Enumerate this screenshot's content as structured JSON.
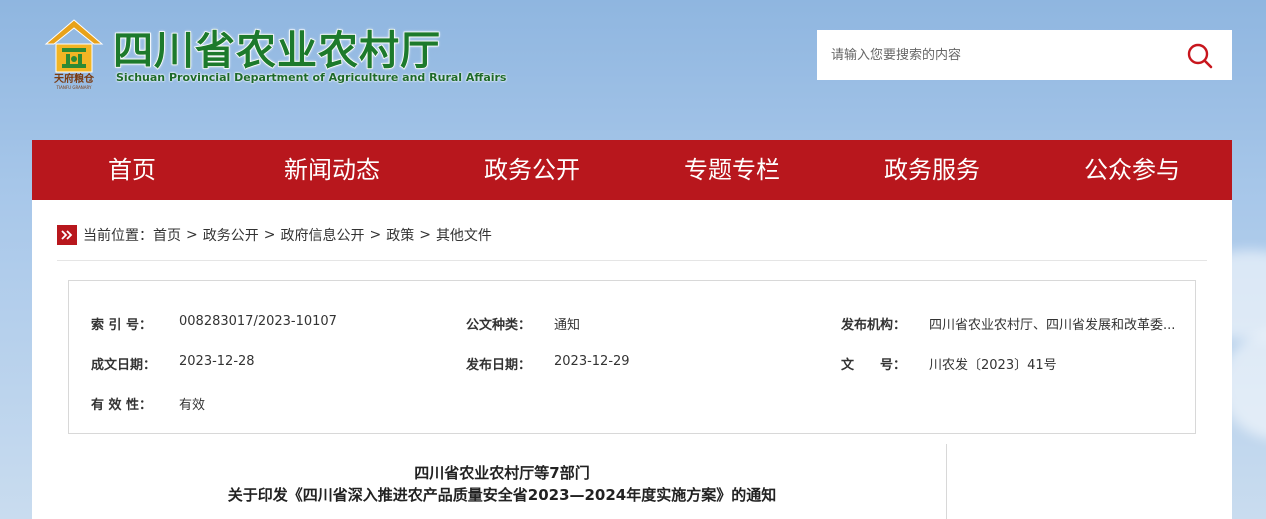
{
  "header": {
    "emblem_caption": "天府粮仓",
    "emblem_caption_en": "TIANFU GRANARY",
    "title_cn": "四川省农业农村厅",
    "title_en": "Sichuan Provincial Department of Agriculture and Rural Affairs",
    "brand_green": "#1d7a2c"
  },
  "search": {
    "placeholder": "请输入您要搜索的内容",
    "icon": "search-icon",
    "icon_color": "#c8161d"
  },
  "nav": {
    "color": "#b8171d",
    "items": [
      {
        "label": "首页"
      },
      {
        "label": "新闻动态"
      },
      {
        "label": "政务公开"
      },
      {
        "label": "专题专栏"
      },
      {
        "label": "政务服务"
      },
      {
        "label": "公众参与"
      }
    ]
  },
  "breadcrumb": {
    "icon": "double-chevron-right-icon",
    "prefix": "当前位置：",
    "items": [
      "首页",
      "政务公开",
      "政府信息公开",
      "政策",
      "其他文件"
    ],
    "separator": ">"
  },
  "meta": {
    "row1": [
      {
        "label": "索 引 号：",
        "value": "008283017/2023-10107"
      },
      {
        "label": "公文种类：",
        "value": "通知"
      },
      {
        "label": "发布机构：",
        "value": "四川省农业农村厅、四川省发展和改革委..."
      }
    ],
    "row2": [
      {
        "label": "成文日期：",
        "value": "2023-12-28"
      },
      {
        "label": "发布日期：",
        "value": "2023-12-29"
      },
      {
        "label": "文　　号：",
        "value": "川农发〔2023〕41号"
      }
    ],
    "row3": [
      {
        "label": "有 效 性：",
        "value": "有效"
      }
    ]
  },
  "document": {
    "title_line1": "四川省农业农村厅等7部门",
    "title_line2": "关于印发《四川省深入推进农产品质量安全省2023—2024年度实施方案》的通知"
  }
}
